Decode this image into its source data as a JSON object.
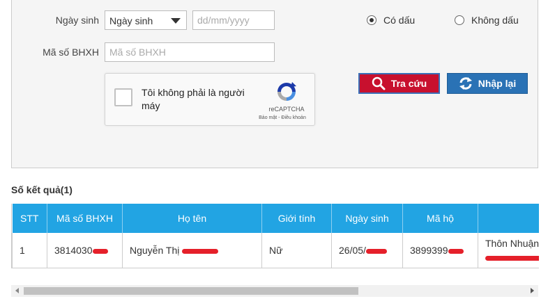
{
  "form": {
    "dob_label": "Ngày sinh",
    "dob_select_value": "Ngày sinh",
    "dob_input_placeholder": "dd/mm/yyyy",
    "bhxh_label": "Mã số BHXH",
    "bhxh_input_placeholder": "Mã số BHXH",
    "radio_accent": "Có dấu",
    "radio_no_accent": "Không dấu",
    "radio_selected": "Có dấu"
  },
  "captcha": {
    "label": "Tôi không phải là người máy",
    "brand": "reCAPTCHA",
    "terms": "Bảo mật - Điều khoản"
  },
  "buttons": {
    "search_label": "Tra cứu",
    "reset_label": "Nhập lại"
  },
  "results": {
    "count_label": "Số kết quả(1)",
    "columns": [
      "STT",
      "Mã số BHXH",
      "Họ tên",
      "Giới tính",
      "Ngày sinh",
      "Mã hộ",
      ""
    ],
    "rows": [
      {
        "stt": "1",
        "bhxh": "3814030",
        "name": "Nguyễn Thị",
        "gender": "Nữ",
        "dob": "26/05/",
        "household": "3899399",
        "address": "Thôn Nhuận"
      }
    ]
  },
  "colors": {
    "header_bg": "#22a4e3",
    "search_bg": "#c8102e",
    "reset_bg": "#2a72b5",
    "redaction": "#e5202a"
  }
}
